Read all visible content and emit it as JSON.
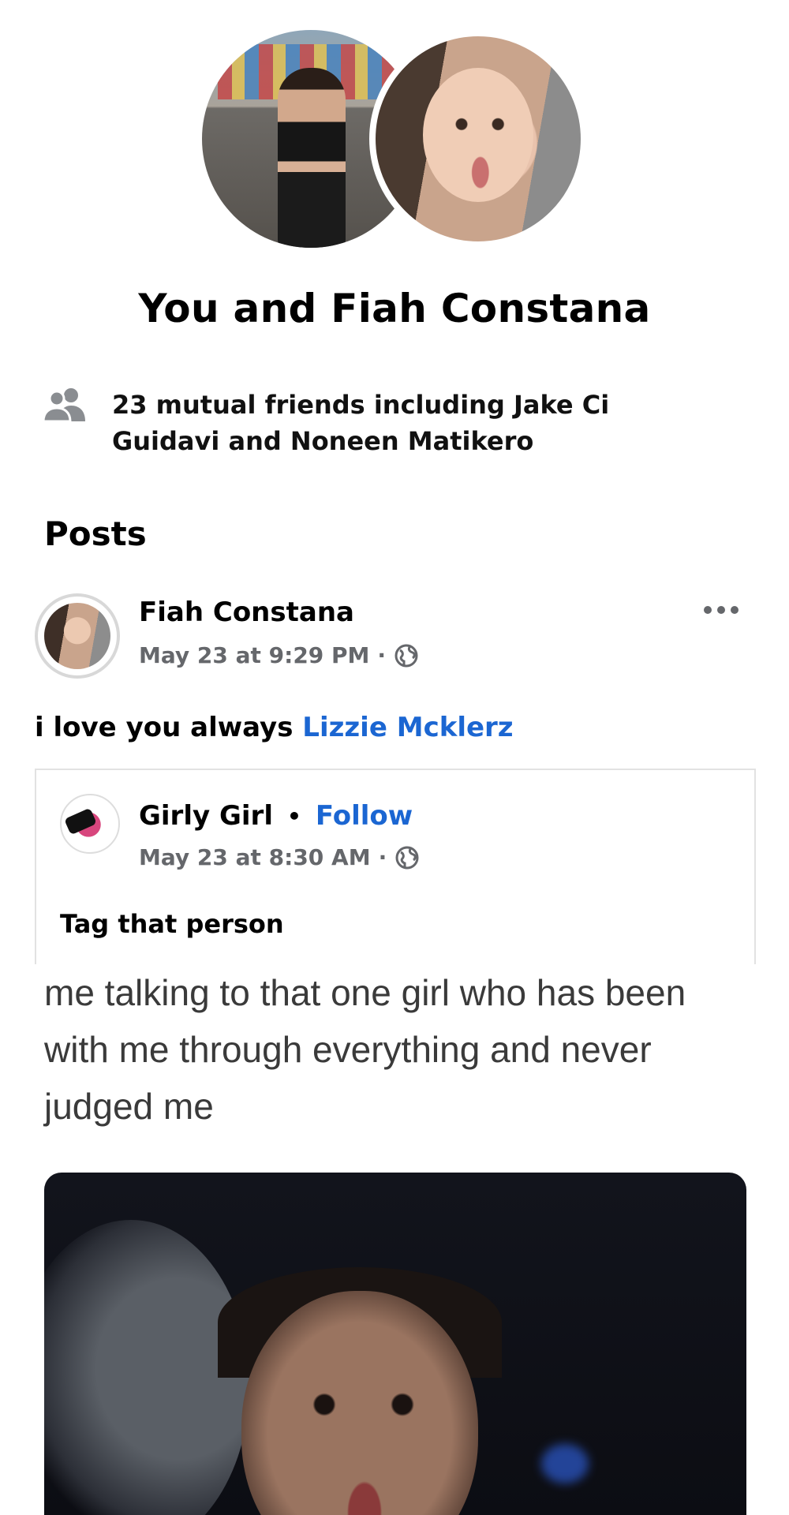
{
  "header": {
    "title": "You and Fiah Constana"
  },
  "mutual_friends": {
    "icon": "people-icon",
    "text": "23 mutual friends including Jake Ci Guidavi and Noneen Matikero"
  },
  "posts_section": {
    "heading": "Posts"
  },
  "post": {
    "author": "Fiah Constana",
    "timestamp": "May 23 at 9:29 PM",
    "separator": "·",
    "privacy_icon": "globe-icon",
    "more_icon": "more-horizontal-icon",
    "text_prefix": "i love you always",
    "mention": "Lizzie Mcklerz",
    "shared": {
      "page_name": "Girly Girl",
      "dot": "•",
      "follow_label": "Follow",
      "timestamp": "May 23 at 8:30 AM",
      "separator": "·",
      "privacy_icon": "globe-icon",
      "caption": "Tag that person",
      "meme_text": "me talking to that one girl who has been with me through everything and never judged me"
    }
  },
  "colors": {
    "link_blue": "#1b66d2",
    "meta_gray": "#65676b",
    "icon_gray": "#8a8d91"
  }
}
